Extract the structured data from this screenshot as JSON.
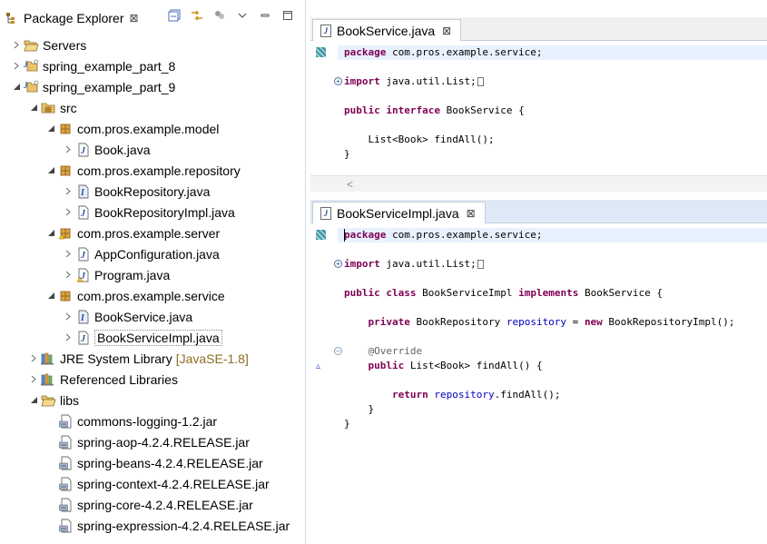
{
  "package_explorer": {
    "title": "Package Explorer",
    "close_glyph": "⊠",
    "toolbar": [
      "collapse-all-icon",
      "link-with-editor-icon",
      "filters-icon",
      "view-menu-icon",
      "minimize-icon",
      "maximize-icon"
    ],
    "tree": [
      {
        "label": "Servers",
        "icon": "folder-open-icon",
        "twisty": "collapsed"
      },
      {
        "label": "spring_example_part_8",
        "icon": "project-icon",
        "twisty": "collapsed"
      },
      {
        "label": "spring_example_part_9",
        "icon": "project-icon",
        "twisty": "expanded"
      },
      {
        "label": "src",
        "icon": "source-folder-icon",
        "twisty": "expanded"
      },
      {
        "label": "com.pros.example.model",
        "icon": "package-icon",
        "twisty": "expanded"
      },
      {
        "label": "Book.java",
        "icon": "java-file-icon",
        "twisty": "collapsed"
      },
      {
        "label": "com.pros.example.repository",
        "icon": "package-icon",
        "twisty": "expanded"
      },
      {
        "label": "BookRepository.java",
        "icon": "java-interface-file-icon",
        "twisty": "collapsed"
      },
      {
        "label": "BookRepositoryImpl.java",
        "icon": "java-file-icon",
        "twisty": "collapsed"
      },
      {
        "label": "com.pros.example.server",
        "icon": "package-warning-icon",
        "twisty": "expanded"
      },
      {
        "label": "AppConfiguration.java",
        "icon": "java-file-icon",
        "twisty": "collapsed"
      },
      {
        "label": "Program.java",
        "icon": "java-file-warning-icon",
        "twisty": "collapsed"
      },
      {
        "label": "com.pros.example.service",
        "icon": "package-icon",
        "twisty": "expanded"
      },
      {
        "label": "BookService.java",
        "icon": "java-interface-file-icon",
        "twisty": "collapsed"
      },
      {
        "label": "BookServiceImpl.java",
        "icon": "java-file-icon",
        "twisty": "collapsed",
        "selected": true
      },
      {
        "label": "JRE System Library",
        "decoration": "[JavaSE-1.8]",
        "icon": "library-icon",
        "twisty": "collapsed"
      },
      {
        "label": "Referenced Libraries",
        "icon": "library-icon",
        "twisty": "collapsed"
      },
      {
        "label": "libs",
        "icon": "folder-open-icon",
        "twisty": "expanded"
      },
      {
        "label": "commons-logging-1.2.jar",
        "icon": "jar-file-icon",
        "twisty": "none"
      },
      {
        "label": "spring-aop-4.2.4.RELEASE.jar",
        "icon": "jar-file-icon",
        "twisty": "none"
      },
      {
        "label": "spring-beans-4.2.4.RELEASE.jar",
        "icon": "jar-file-icon",
        "twisty": "none"
      },
      {
        "label": "spring-context-4.2.4.RELEASE.jar",
        "icon": "jar-file-icon",
        "twisty": "none"
      },
      {
        "label": "spring-core-4.2.4.RELEASE.jar",
        "icon": "jar-file-icon",
        "twisty": "none"
      },
      {
        "label": "spring-expression-4.2.4.RELEASE.jar",
        "icon": "jar-file-icon",
        "twisty": "none"
      }
    ]
  },
  "editor_top": {
    "tab_label": "BookService.java",
    "close_glyph": "⊠",
    "lines": [
      [
        {
          "t": "package",
          "c": "kw"
        },
        {
          "t": " com.pros.example.service;"
        }
      ],
      [],
      [
        {
          "t": "import",
          "c": "kw"
        },
        {
          "t": " java.util.List;"
        }
      ],
      [],
      [
        {
          "t": "public",
          "c": "kw"
        },
        {
          "t": " "
        },
        {
          "t": "interface",
          "c": "kw"
        },
        {
          "t": " BookService {"
        }
      ],
      [],
      [
        {
          "t": "    List<Book> findAll();"
        }
      ],
      [
        {
          "t": "}"
        }
      ]
    ]
  },
  "editor_bottom": {
    "tab_label": "BookServiceImpl.java",
    "close_glyph": "⊠",
    "lines": [
      [
        {
          "t": "package",
          "c": "kw"
        },
        {
          "t": " com.pros.example.service;"
        }
      ],
      [],
      [
        {
          "t": "import",
          "c": "kw"
        },
        {
          "t": " java.util.List;"
        }
      ],
      [],
      [
        {
          "t": "public",
          "c": "kw"
        },
        {
          "t": " "
        },
        {
          "t": "class",
          "c": "kw"
        },
        {
          "t": " BookServiceImpl "
        },
        {
          "t": "implements",
          "c": "kw"
        },
        {
          "t": " BookService {"
        }
      ],
      [],
      [
        {
          "t": "    "
        },
        {
          "t": "private",
          "c": "kw"
        },
        {
          "t": " BookRepository "
        },
        {
          "t": "repository",
          "c": "fld"
        },
        {
          "t": " = "
        },
        {
          "t": "new",
          "c": "kw"
        },
        {
          "t": " BookRepositoryImpl();"
        }
      ],
      [],
      [
        {
          "t": "    "
        },
        {
          "t": "@Override",
          "c": "ann"
        }
      ],
      [
        {
          "t": "    "
        },
        {
          "t": "public",
          "c": "kw"
        },
        {
          "t": " List<Book> findAll() {"
        }
      ],
      [],
      [
        {
          "t": "        "
        },
        {
          "t": "return",
          "c": "kw"
        },
        {
          "t": " "
        },
        {
          "t": "repository",
          "c": "fld"
        },
        {
          "t": ".findAll();"
        }
      ],
      [
        {
          "t": "    }"
        }
      ],
      [
        {
          "t": "}"
        }
      ]
    ]
  },
  "colors": {
    "keyword": "#7f0055",
    "field": "#0000c0",
    "annotation": "#646464",
    "current_line": "#e8f2fe",
    "decoration": "#8c6d1f"
  }
}
